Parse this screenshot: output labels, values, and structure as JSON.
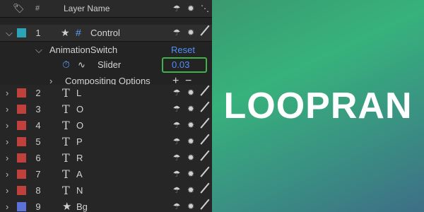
{
  "header": {
    "label_icon": "tag-icon",
    "num_label": "#",
    "layer_name_label": "Layer Name"
  },
  "control_row": {
    "number": "1",
    "name": "Control",
    "swatch_color": "#2aa5b8"
  },
  "effect": {
    "name": "AnimationSwitch",
    "reset_label": "Reset"
  },
  "slider": {
    "name": "Slider",
    "value": "0.03"
  },
  "compositing": {
    "label": "Compositing Options",
    "plus": "+",
    "minus": "−"
  },
  "layers": [
    {
      "number": "2",
      "glyph": "T",
      "name": "L",
      "color": "#c0413c"
    },
    {
      "number": "3",
      "glyph": "T",
      "name": "O",
      "color": "#c0413c"
    },
    {
      "number": "4",
      "glyph": "T",
      "name": "O",
      "color": "#c0413c"
    },
    {
      "number": "5",
      "glyph": "T",
      "name": "P",
      "color": "#c0413c"
    },
    {
      "number": "6",
      "glyph": "T",
      "name": "R",
      "color": "#c0413c"
    },
    {
      "number": "7",
      "glyph": "T",
      "name": "A",
      "color": "#c0413c"
    },
    {
      "number": "8",
      "glyph": "T",
      "name": "N",
      "color": "#c0413c"
    },
    {
      "number": "9",
      "glyph": "★",
      "name": "Bg",
      "color": "#5b73d8"
    }
  ],
  "preview": {
    "brand_text": "LOOPRAN"
  },
  "colors": {
    "accent_blue": "#4f8ff7",
    "highlight_green": "#3fb24a"
  }
}
